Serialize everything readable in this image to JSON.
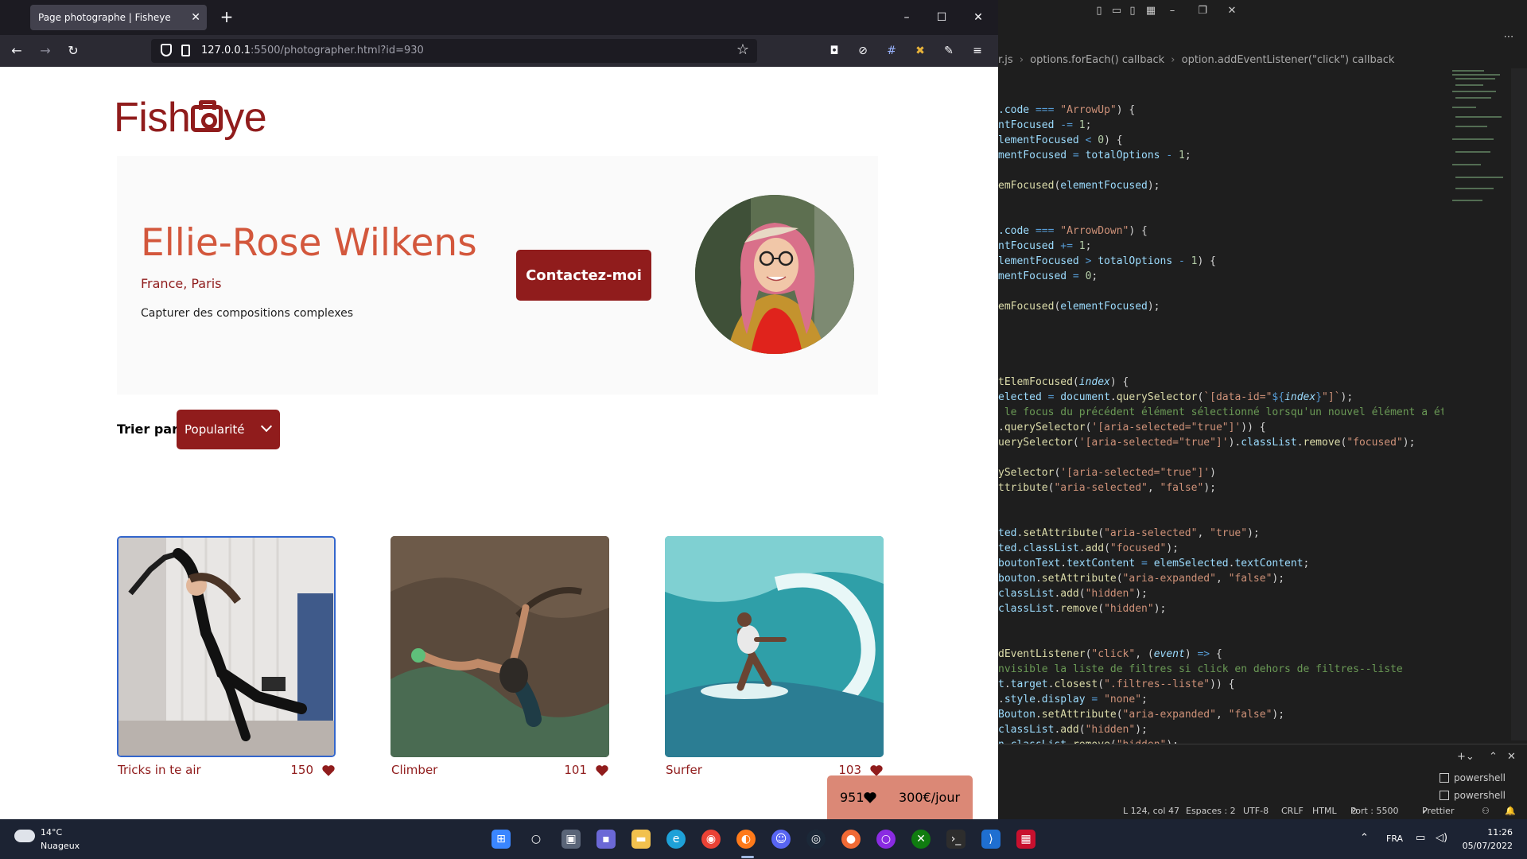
{
  "browser": {
    "tab_title": "Page photographe | Fisheye",
    "url_host": "127.0.0.1",
    "url_rest": ":5500/photographer.html?id=930"
  },
  "page": {
    "logo_prefix": "Fish",
    "logo_suffix": "ye",
    "photographer": {
      "name": "Ellie-Rose Wilkens",
      "location": "France, Paris",
      "tagline": "Capturer des compositions complexes"
    },
    "contact_label": "Contactez-moi",
    "sort": {
      "label": "Trier par",
      "selected": "Popularité"
    },
    "media": [
      {
        "title": "Tricks in te air",
        "likes": "150",
        "focused": true
      },
      {
        "title": "Climber",
        "likes": "101",
        "focused": false
      },
      {
        "title": "Surfer",
        "likes": "103",
        "focused": false
      }
    ],
    "stats": {
      "total_likes": "951",
      "price": "300€/jour"
    }
  },
  "vscode": {
    "breadcrumb": [
      "r.js",
      "options.forEach() callback",
      "option.addEventListener(\"click\") callback"
    ],
    "status": {
      "position": "L 124, col 47",
      "spaces": "Espaces : 2",
      "encoding": "UTF-8",
      "eol": "CRLF",
      "language": "HTML",
      "port": "Port : 5500",
      "formatter": "Prettier"
    },
    "terminals": [
      "powershell",
      "powershell"
    ]
  },
  "taskbar": {
    "temperature": "14°C",
    "weather": "Nuageux",
    "language": "FRA",
    "time": "11:26",
    "date": "05/07/2022"
  },
  "colors": {
    "brand": "#901c1c",
    "accent": "#d3573c",
    "stats_bg": "#db8876"
  }
}
